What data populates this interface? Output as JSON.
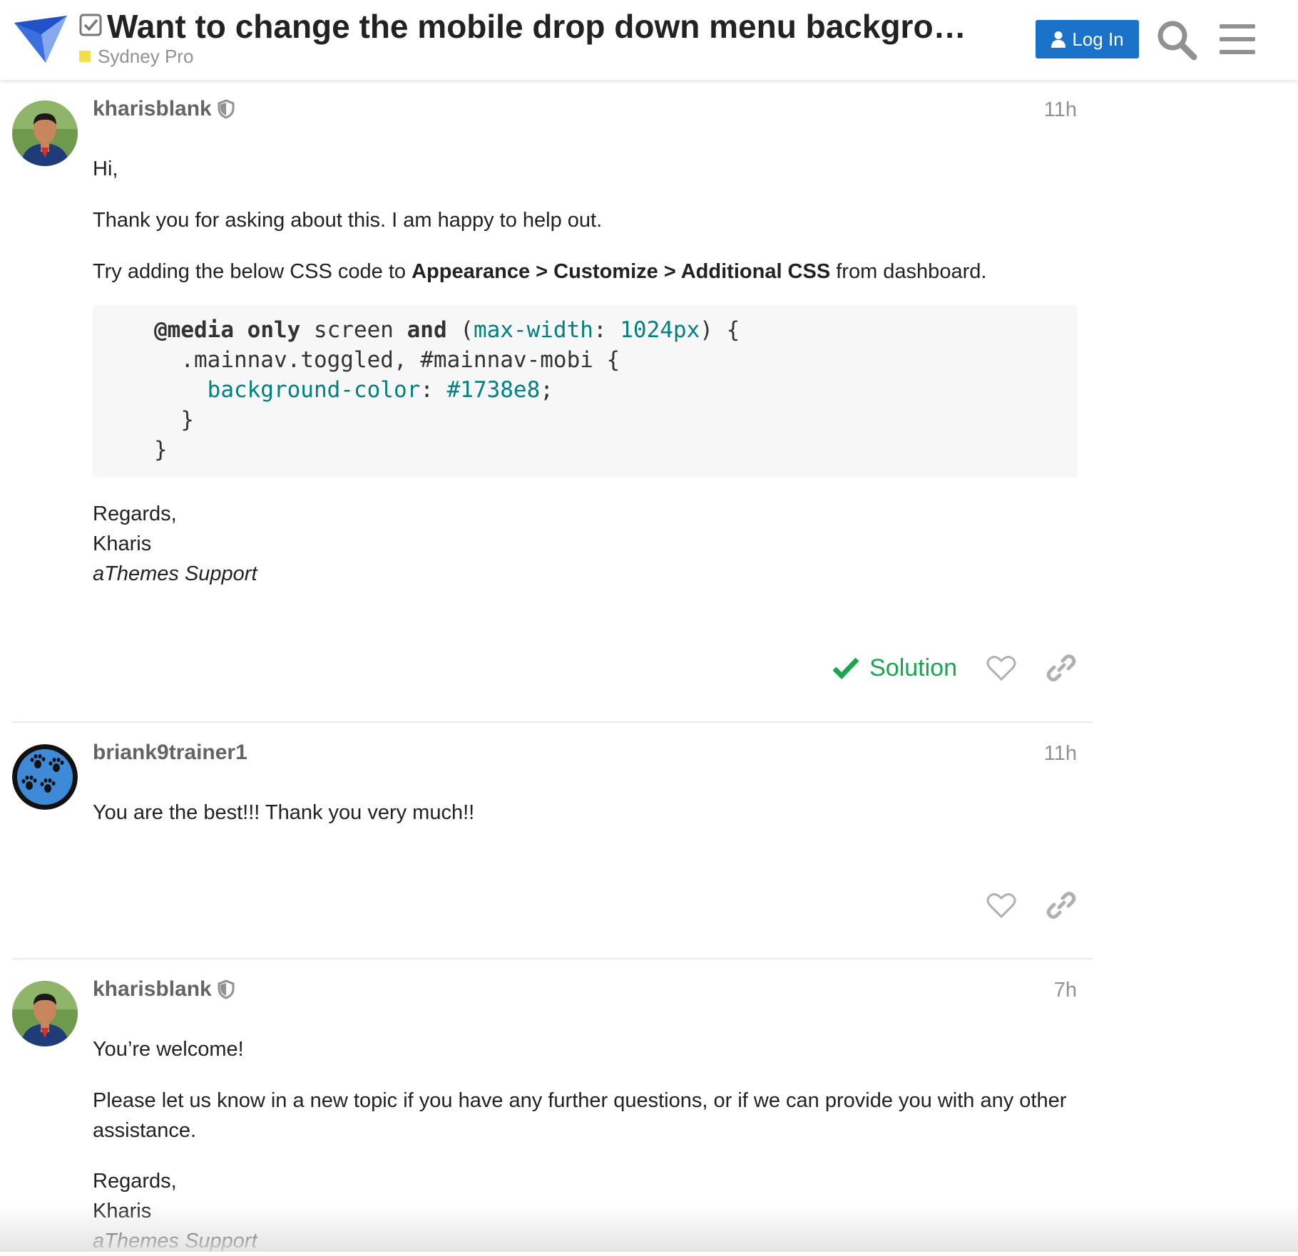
{
  "header": {
    "title": "Want to change the mobile drop down menu backgrou…",
    "category": {
      "name": "Sydney Pro",
      "color": "#f1e047"
    },
    "login_label": "Log In",
    "icons": [
      "logo-icon",
      "checkbox-checked-icon",
      "user-icon",
      "search-icon",
      "hamburger-menu-icon"
    ],
    "accent_color": "#1a73c8"
  },
  "posts": [
    {
      "username": "kharisblank",
      "date": "11h",
      "paragraphs": {
        "greeting": "Hi,",
        "thanks": "Thank you for asking about this. I am happy to help out.",
        "instruction_prefix": "Try adding the below CSS code to ",
        "instruction_path": "Appearance > Customize > Additional CSS",
        "instruction_suffix": " from dashboard."
      },
      "code": {
        "l1_kw1": "@media",
        "l1_kw2": "only",
        "l1_t1": " screen ",
        "l1_kw3": "and",
        "l1_t2": " (",
        "l1_prop": "max-width",
        "l1_t3": ": ",
        "l1_val": "1024px",
        "l1_t4": ") {",
        "l2": "  .mainnav.toggled, #mainnav-mobi {",
        "l3_indent": "    ",
        "l3_prop": "background-color",
        "l3_t1": ": ",
        "l3_val": "#1738e8",
        "l3_t2": ";",
        "l4": "  }",
        "l5": "}"
      },
      "signature": {
        "regards": "Regards,",
        "name": "Kharis",
        "team": "aThemes Support"
      },
      "solution_label": "Solution"
    },
    {
      "username": "briank9trainer1",
      "date": "11h",
      "body": "You are the best!!! Thank you very much!!"
    },
    {
      "username": "kharisblank",
      "date": "7h",
      "welcome": "You’re welcome!",
      "body": "Please let us know in a new topic if you have any further questions, or if we can provide you with any other assistance.",
      "signature": {
        "regards": "Regards,",
        "name": "Kharis",
        "team": "aThemes Support"
      }
    }
  ],
  "colors": {
    "solution_green": "#1ca551",
    "code_teal": "#008080",
    "muted_text": "#919191"
  }
}
